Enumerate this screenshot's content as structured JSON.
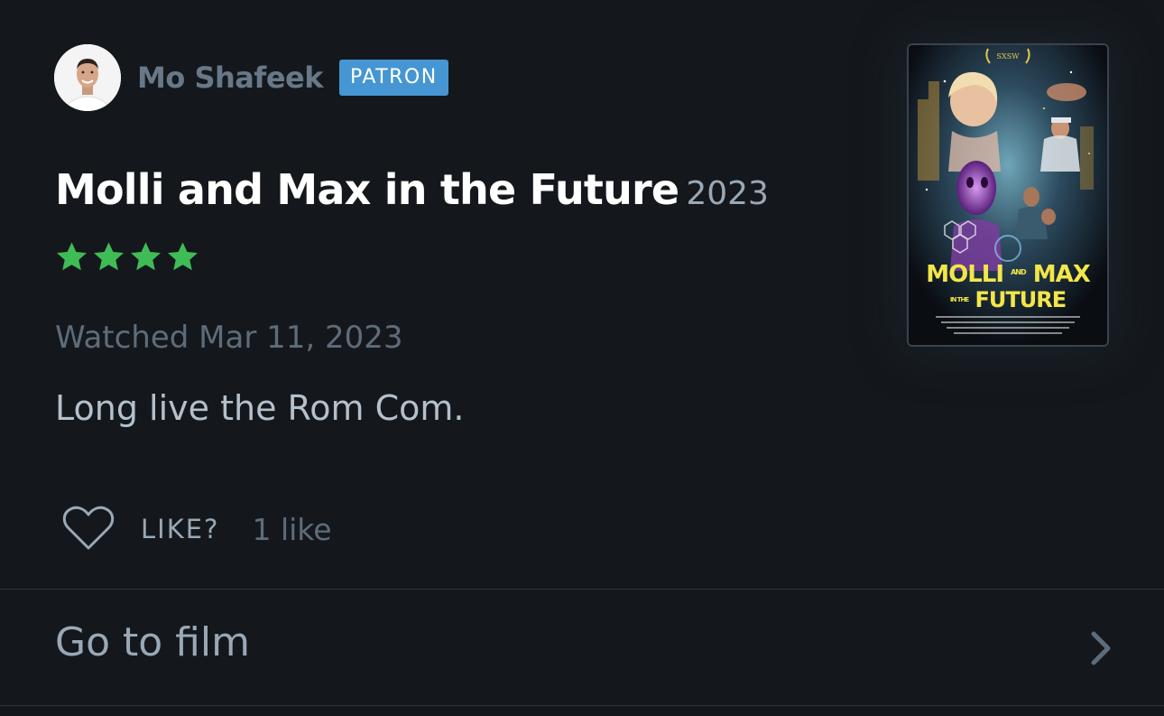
{
  "review": {
    "author": {
      "name": "Mo Shafeek",
      "badge": "PATRON"
    },
    "film": {
      "title": "Molli and Max in the Future",
      "year": "2023"
    },
    "rating": 4,
    "rating_max": 5,
    "star_color": "#40bc57",
    "watched": "Watched Mar 11, 2023",
    "text": "Long live the Rom Com.",
    "like": {
      "label": "LIKE?",
      "count": "1 like"
    }
  },
  "poster": {
    "title_line_1": "MOLLI",
    "title_line_1_small": "AND",
    "title_line_1_b": "MAX",
    "title_line_2": "FUTURE",
    "title_line_2_small": "IN THE",
    "festival": "SXSW"
  },
  "navigation": {
    "goto_label": "Go to film",
    "chevron_icon": "chevron-right-icon"
  },
  "colors": {
    "background": "#14181c",
    "badge": "#4596d2",
    "accent_green": "#40bc57"
  }
}
